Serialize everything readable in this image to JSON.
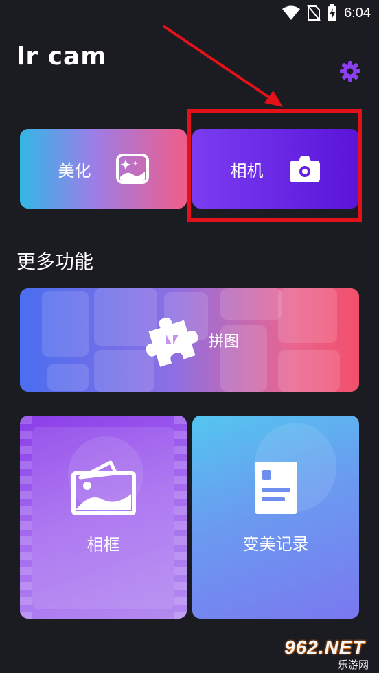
{
  "status_bar": {
    "time": "6:04"
  },
  "header": {
    "app_title": "lr cam"
  },
  "top_cards": {
    "beautify_label": "美化",
    "camera_label": "相机"
  },
  "section": {
    "title": "更多功能"
  },
  "features": {
    "collage_label": "拼图",
    "frame_label": "相框",
    "record_label": "变美记录"
  },
  "watermark": {
    "main": "962.NET",
    "sub": "乐游网"
  },
  "colors": {
    "background": "#1b1b22",
    "accent_purple": "#7a3df1",
    "highlight_red": "#e3111a"
  },
  "icons": {
    "settings": "gear-icon",
    "beautify": "image-sparkle-icon",
    "camera": "camera-icon",
    "collage": "puzzle-icon",
    "frame": "photo-frame-icon",
    "record": "document-icon"
  }
}
